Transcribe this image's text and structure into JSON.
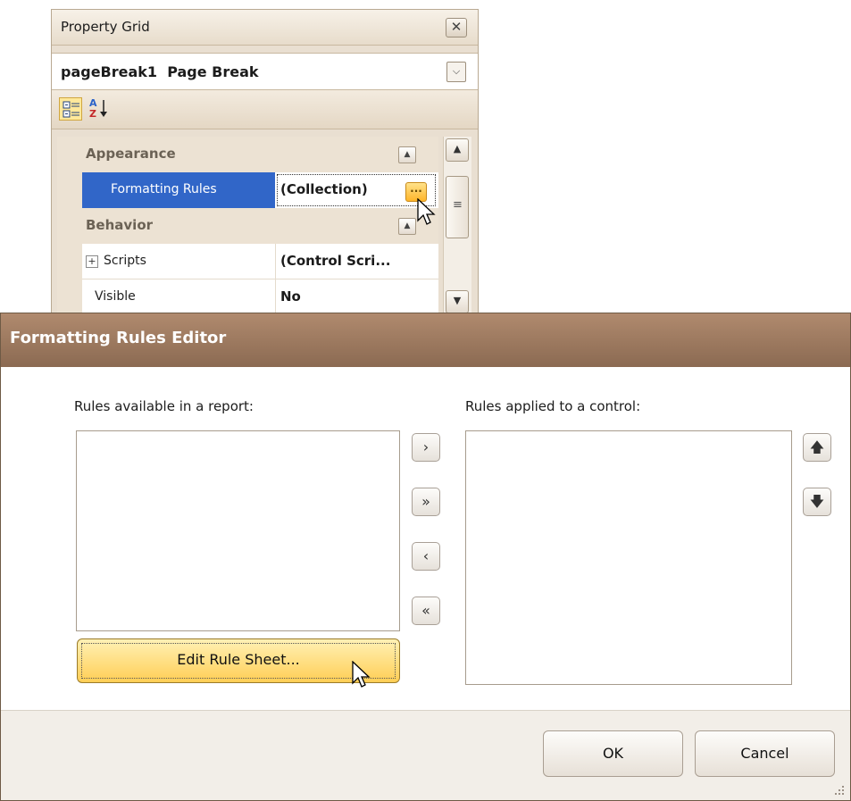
{
  "property_grid": {
    "title": "Property Grid",
    "close_glyph": "✕",
    "object_selector": {
      "name": "pageBreak1",
      "type": "Page Break",
      "dropdown_glyph": "⌵"
    },
    "toolbar": {
      "categorized_icon": "categorized-view-icon",
      "alphabetical_icon": "sort-az-icon"
    },
    "categories": [
      {
        "name": "Appearance",
        "collapse_glyph": "▲"
      },
      {
        "name": "Behavior",
        "collapse_glyph": "▲"
      }
    ],
    "properties": [
      {
        "name": "Formatting Rules",
        "value": "(Collection)",
        "selected": true,
        "ellipsis_glyph": "···"
      },
      {
        "name": "Scripts",
        "value": "(Control Scri...",
        "expand_glyph": "+"
      },
      {
        "name": "Visible",
        "value": "No"
      }
    ],
    "scrollbar": {
      "up_glyph": "▲",
      "down_glyph": "▼",
      "thumb_glyph": "≡"
    }
  },
  "dialog": {
    "title": "Formatting Rules Editor",
    "available_label": "Rules available in a report:",
    "applied_label": "Rules applied to a control:",
    "move_buttons": {
      "add": "›",
      "add_all": "»",
      "remove": "‹",
      "remove_all": "«"
    },
    "order_buttons": {
      "up": "🡅",
      "down": "🡇"
    },
    "edit_button": "Edit Rule Sheet...",
    "ok_button": "OK",
    "cancel_button": "Cancel"
  },
  "colors": {
    "selection": "#3166c8",
    "dialog_title": "#8b6a52",
    "accent_button": "#ffce55"
  }
}
